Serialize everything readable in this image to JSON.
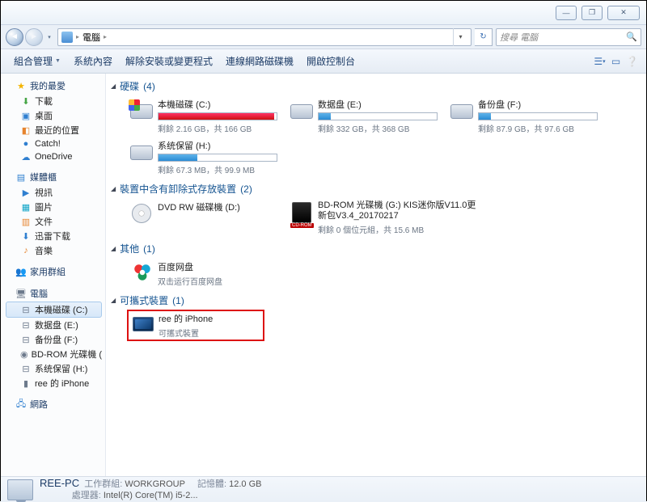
{
  "titlebar": {
    "min": "—",
    "max": "❐",
    "close": "✕"
  },
  "address": {
    "crumb": "電腦",
    "arrow": "▸",
    "refresh": "↻",
    "dropdown": "▾"
  },
  "search": {
    "placeholder": "搜尋 電腦",
    "icon": "🔍"
  },
  "toolbar": {
    "organize": "組合管理",
    "sysprops": "系統內容",
    "uninstall": "解除安裝或變更程式",
    "mapdrive": "連線網路磁碟機",
    "controlpanel": "開啟控制台"
  },
  "sidebar": {
    "favorites": {
      "label": "我的最愛",
      "items": [
        "下載",
        "桌面",
        "最近的位置",
        "Catch!",
        "OneDrive"
      ]
    },
    "libraries": {
      "label": "媒體櫃",
      "items": [
        "視訊",
        "圖片",
        "文件",
        "迅雷下载",
        "音樂"
      ]
    },
    "homegroup": {
      "label": "家用群組"
    },
    "computer": {
      "label": "電腦",
      "items": [
        "本機磁碟 (C:)",
        "数据盘 (E:)",
        "备份盘 (F:)",
        "BD-ROM 光碟機 (",
        "系统保留 (H:)",
        "ree 的 iPhone"
      ]
    },
    "network": {
      "label": "網路"
    }
  },
  "sections": {
    "drives": {
      "label": "硬碟",
      "count": "(4)"
    },
    "removable": {
      "label": "裝置中含有卸除式存放裝置",
      "count": "(2)"
    },
    "other": {
      "label": "其他",
      "count": "(1)"
    },
    "portable": {
      "label": "可攜式裝置",
      "count": "(1)"
    }
  },
  "drives": [
    {
      "label": "本機磁碟 (C:)",
      "sub": "剩餘 2.16 GB，共 166 GB",
      "fill": 98,
      "color": "red"
    },
    {
      "label": "数据盘 (E:)",
      "sub": "剩餘 332 GB，共 368 GB",
      "fill": 10,
      "color": "blue"
    },
    {
      "label": "备份盘 (F:)",
      "sub": "剩餘 87.9 GB，共 97.6 GB",
      "fill": 10,
      "color": "blue"
    },
    {
      "label": "系统保留 (H:)",
      "sub": "剩餘 67.3 MB，共 99.9 MB",
      "fill": 33,
      "color": "blue"
    }
  ],
  "removable": {
    "dvd": {
      "label": "DVD RW 磁碟機 (D:)"
    },
    "bd": {
      "label": "BD-ROM 光碟機 (G:) KIS迷你版V11.0更新包V3.4_20170217",
      "sub": "剩餘 0 個位元組，共 15.6 MB"
    }
  },
  "other": {
    "baidu": {
      "label": "百度网盘",
      "sub": "双击运行百度网盘"
    }
  },
  "portable": {
    "iphone": {
      "label": "ree 的 iPhone",
      "sub": "可攜式裝置"
    }
  },
  "status": {
    "pcname": "REE-PC",
    "workgroup_label": "工作群組:",
    "workgroup_value": "WORKGROUP",
    "mem_label": "記憶體:",
    "mem_value": "12.0 GB",
    "cpu_label": "處理器:",
    "cpu_value": "Intel(R) Core(TM) i5-2..."
  }
}
